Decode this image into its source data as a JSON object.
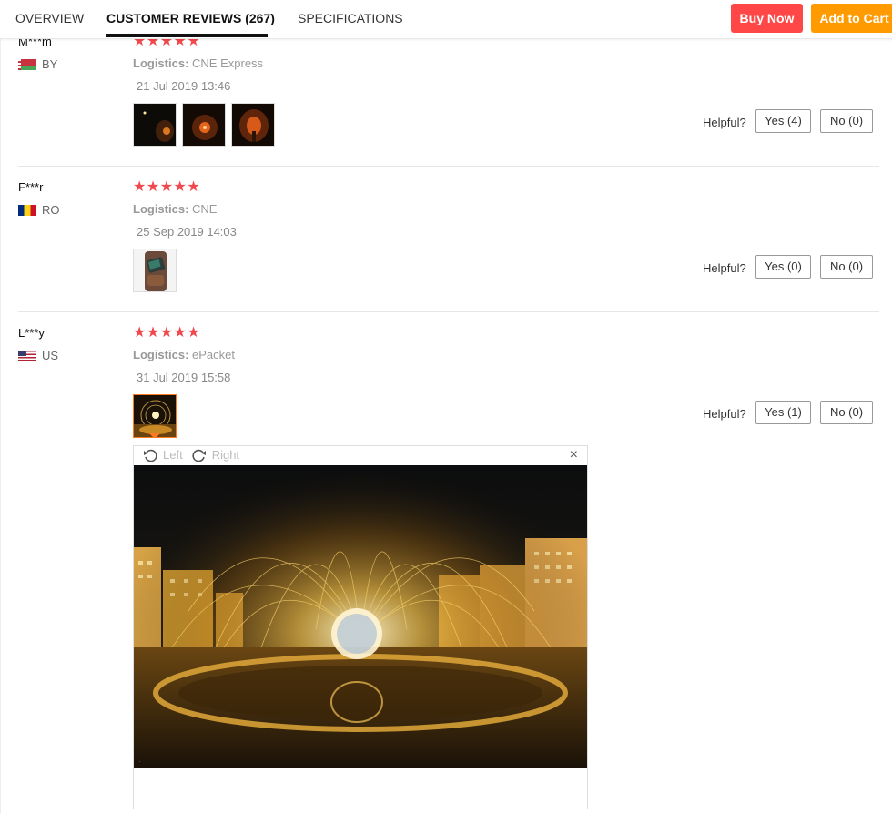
{
  "tabs": [
    {
      "label": "OVERVIEW"
    },
    {
      "label": "CUSTOMER REVIEWS (267)"
    },
    {
      "label": "SPECIFICATIONS"
    }
  ],
  "actions": {
    "buy_now": "Buy Now",
    "add_to_cart": "Add to Cart"
  },
  "colors": {
    "buy_now": "#ff4747",
    "add_to_cart": "#ff9a00",
    "stars": "#f0484d"
  },
  "helpful_label": "Helpful?",
  "reviews": [
    {
      "user": "M***m",
      "country": "BY",
      "stars": "★★★★★",
      "logistics_label": "Logistics:",
      "logistics": "CNE Express",
      "date": "21 Jul 2019 13:46",
      "yes": "Yes (4)",
      "no": "No (0)"
    },
    {
      "user": "F***r",
      "country": "RO",
      "stars": "★★★★★",
      "logistics_label": "Logistics:",
      "logistics": "CNE",
      "date": "25 Sep 2019 14:03",
      "yes": "Yes (0)",
      "no": "No (0)"
    },
    {
      "user": "L***y",
      "country": "US",
      "stars": "★★★★★",
      "logistics_label": "Logistics:",
      "logistics": "ePacket",
      "date": "31 Jul 2019 15:58",
      "yes": "Yes (1)",
      "no": "No (0)"
    }
  ],
  "viewer": {
    "rotate_left": "Left",
    "rotate_right": "Right",
    "close": "×"
  }
}
